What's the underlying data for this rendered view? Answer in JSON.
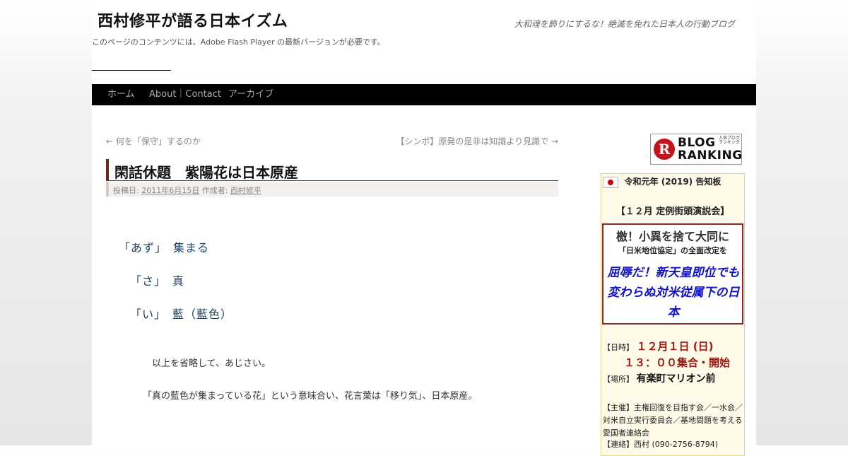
{
  "site": {
    "title": "西村修平が語る日本イズム",
    "description": "大和魂を飾りにするな！絶滅を免れた日本人の行動ブログ",
    "flash_note": "このページのコンテンツには、Adobe Flash Player の最新バージョンが必要です。"
  },
  "nav": {
    "items": [
      {
        "label": "ホーム"
      },
      {
        "label": "About｜Contact"
      },
      {
        "label": "アーカイブ"
      }
    ]
  },
  "post_nav": {
    "prev": "← 何を「保守」するのか",
    "next": "【シンポ】原発の是非は知識より見識で →"
  },
  "post": {
    "title": "閑話休題　紫陽花は日本原産",
    "meta_prefix": "投稿日:",
    "date": "2011年6月15日",
    "author_prefix": "作成者:",
    "author": "西村修平",
    "poem": [
      "「あず」　集まる",
      "「さ」　真",
      "「い」　藍（藍色）"
    ],
    "paragraphs": [
      "以上を省略して、あじさい。",
      "「真の藍色が集まっている花」という意味合い、花言葉は「移り気」、日本原産。"
    ]
  },
  "sidebar": {
    "ranking": {
      "line1": "BLOG",
      "line2": "RANKING",
      "small": "人気ブログランキング",
      "logo_letter": "R"
    },
    "notice": {
      "title": "令和元年 (2019) 告知板",
      "event_title": "【１２月 定例街頭演説会】",
      "poster_line1": "檄！小異を捨て大同に",
      "poster_line2": "「日米地位協定」の全面改定を",
      "poster_line3": "屈辱だ！新天皇即位でも変わらぬ対米従属下の日本",
      "date_label": "【日時】",
      "date_value": "１２月１日 (日)",
      "time_value": "１３：００集合・開始",
      "place_label": "【場所】",
      "place_value": "有楽町マリオン前",
      "organizer": "【主催】主権回復を目指す会／一水会／対米自立実行委員会／基地問題を考える愛国者連絡会",
      "contact": "【連絡】西村 (090-2756-8794)"
    }
  },
  "colors": {
    "nav_bg": "#000000",
    "title_accent": "#6a2b1f",
    "poem_text": "#1d3f66",
    "poster_blue": "#1111cc",
    "notice_red": "#a0150f"
  }
}
